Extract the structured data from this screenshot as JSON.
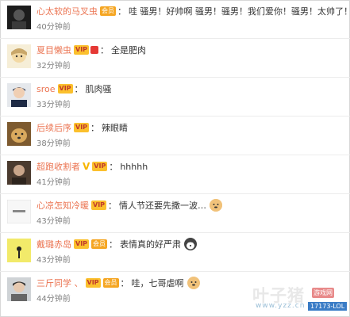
{
  "comments": [
    {
      "username": "心太软的马叉虫",
      "text": "哇 骚男！好帅啊 骚男！骚男！我们爱你！骚男！太帅了！",
      "time": "40分钟前",
      "emoji": ""
    },
    {
      "username": "夏目懒虫",
      "text": "全是肥肉",
      "time": "32分钟前",
      "emoji": ""
    },
    {
      "username": "sroe",
      "text": "肌肉骚",
      "time": "33分钟前",
      "emoji": ""
    },
    {
      "username": "后续后序",
      "text": "辣眼睛",
      "time": "38分钟前",
      "emoji": ""
    },
    {
      "username": "超跑收割者",
      "text": "hhhhh",
      "time": "41分钟前",
      "emoji": ""
    },
    {
      "username": "心凉怎知冷暖",
      "text": "情人节还要先撒一波…",
      "time": "43分钟前",
      "emoji": "doge"
    },
    {
      "username": "戴璐赤岛",
      "text": "表情真的好严肃",
      "time": "43分钟前",
      "emoji": "husky"
    },
    {
      "username": "三斤同学 、",
      "text": "哇，七哥虐啊",
      "time": "44分钟前",
      "emoji": "doge"
    }
  ],
  "badges": {
    "member": "会员",
    "vip": "VIP"
  },
  "watermark": {
    "site": "叶子猪",
    "tag": "游戏网",
    "url": "www.yzz.cn",
    "brand": "17173-LOL"
  }
}
